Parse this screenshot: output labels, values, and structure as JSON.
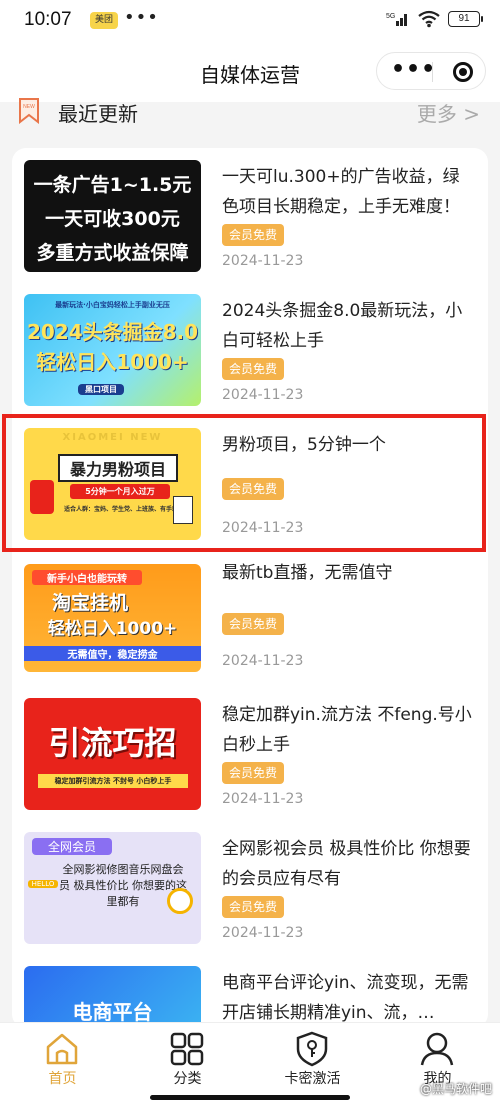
{
  "status_bar": {
    "time": "10:07",
    "app_badge": "美团",
    "dots": "•••",
    "network": "5G",
    "battery": "91"
  },
  "nav": {
    "title": "自媒体运营",
    "more_icon": "more-dots-icon",
    "close_icon": "target-icon"
  },
  "section": {
    "title": "最近更新",
    "more": "更多 >",
    "icon_text": "NEW"
  },
  "items": [
    {
      "title": "一天可lu.300+的广告收益，绿色项目长期稳定，上手无难度！",
      "badge": "会员免费",
      "date": "2024-11-23",
      "thumb_lines": [
        "一条广告1~1.5元",
        "一天可收300元",
        "多重方式收益保障"
      ]
    },
    {
      "title": "2024头条掘金8.0最新玩法，小白可轻松上手",
      "badge": "会员免费",
      "date": "2024-11-23",
      "thumb_lines": [
        "最新玩法·小白宝妈轻松上手副业无压",
        "2024头条掘金8.0",
        "轻松日入1000+",
        "黑口项目"
      ]
    },
    {
      "title": "男粉项目，5分钟一个",
      "badge": "会员免费",
      "date": "2024-11-23",
      "thumb_lines": [
        "暴力男粉项目",
        "5分钟一个月入过万",
        "适合人群：宝妈、学生党、上班族、有手就行",
        "XIAOMEI NEW"
      ]
    },
    {
      "title": "最新tb直播，无需值守",
      "badge": "会员免费",
      "date": "2024-11-23",
      "thumb_lines": [
        "新手小白也能玩转",
        "淘宝挂机",
        "轻松日入1000+",
        "无需值守，稳定捞金"
      ]
    },
    {
      "title": "稳定加群yin.流方法 不feng.号小白秒上手",
      "badge": "会员免费",
      "date": "2024-11-23",
      "thumb_lines": [
        "引流巧招",
        "稳定加群引流方法 不封号 小白秒上手"
      ]
    },
    {
      "title": "全网影视会员 极具性价比 你想要的会员应有尽有",
      "badge": "会员免费",
      "date": "2024-11-23",
      "thumb_lines": [
        "全网会员",
        "全网影视修图音乐网盘会员 极具性价比 你想要的这里都有",
        "HELLO"
      ]
    },
    {
      "title": "电商平台评论yin、流变现，无需开店铺长期精准yin、流，…",
      "badge": "",
      "date": "",
      "thumb_lines": [
        "电商平台"
      ]
    }
  ],
  "tabs": [
    {
      "label": "首页",
      "icon": "home-icon",
      "active": true
    },
    {
      "label": "分类",
      "icon": "grid-icon",
      "active": false
    },
    {
      "label": "卡密激活",
      "icon": "key-shield-icon",
      "active": false
    },
    {
      "label": "我的",
      "icon": "user-icon",
      "active": false
    }
  ],
  "watermark": "@黑马软件吧",
  "colors": {
    "accent": "#f4b24a",
    "highlight": "#e8231b",
    "active_tab": "#e0a53a"
  }
}
